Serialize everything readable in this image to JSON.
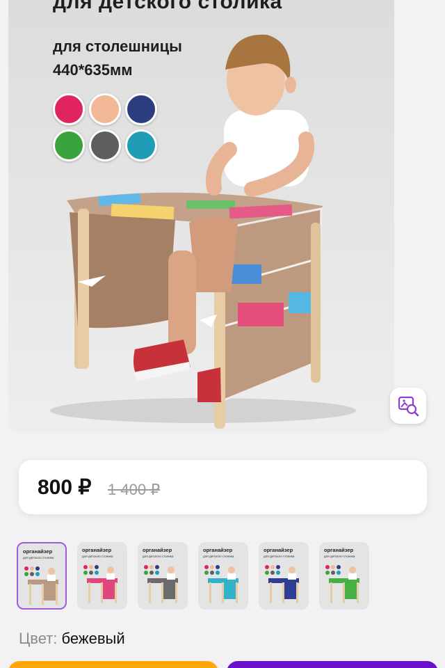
{
  "product_image": {
    "title": "для детского столика",
    "subtitle_line1": "для столешницы",
    "subtitle_line2": "440*635мм",
    "color_swatches": [
      "#e0245e",
      "#f2b896",
      "#2c3e7f",
      "#3aa43c",
      "#5e5e60",
      "#1f9cb6"
    ]
  },
  "price": {
    "current": "800 ₽",
    "old": "1 400 ₽"
  },
  "thumbnails": [
    {
      "title": "органайзер",
      "subtitle": "для детского столика",
      "accent": "#b99a83",
      "selected": true
    },
    {
      "title": "органайзер",
      "subtitle": "для детского столика",
      "accent": "#e0457e",
      "selected": false
    },
    {
      "title": "органайзер",
      "subtitle": "для детского столика",
      "accent": "#6b6b6e",
      "selected": false
    },
    {
      "title": "органайзер",
      "subtitle": "для детского столика",
      "accent": "#30b3c9",
      "selected": false
    },
    {
      "title": "органайзер",
      "subtitle": "для детского столика",
      "accent": "#2f3d93",
      "selected": false
    },
    {
      "title": "органайзер",
      "subtitle": "для детского столика",
      "accent": "#45b043",
      "selected": false
    }
  ],
  "color_selector": {
    "label": "Цвет:",
    "value": "бежевый"
  },
  "icons": {
    "visual_search": "image-search-icon"
  },
  "colors": {
    "accent_purple": "#a35ad8",
    "button_orange": "#ffa80a",
    "button_purple": "#6a11cb"
  }
}
